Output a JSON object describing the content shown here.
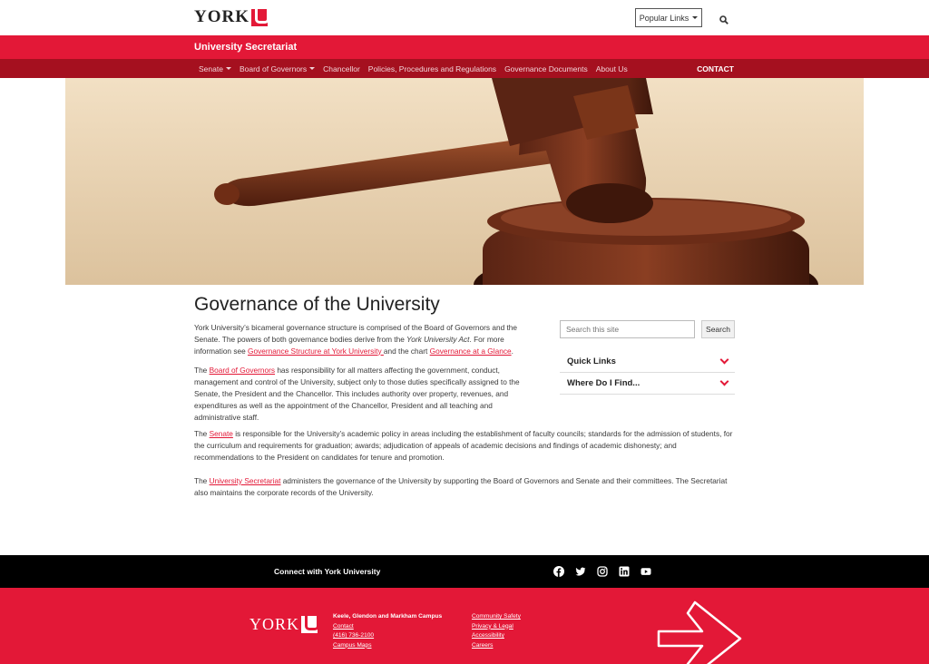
{
  "header": {
    "logo_text": "YORK",
    "popular_links_label": "Popular Links"
  },
  "site": {
    "title": "University Secretariat"
  },
  "nav": {
    "items": [
      {
        "label": "Senate",
        "dropdown": true
      },
      {
        "label": "Board of Governors",
        "dropdown": true
      },
      {
        "label": "Chancellor",
        "dropdown": false
      },
      {
        "label": "Policies, Procedures and Regulations",
        "dropdown": false
      },
      {
        "label": "Governance Documents",
        "dropdown": false
      },
      {
        "label": "About Us",
        "dropdown": false
      }
    ],
    "contact_label": "CONTACT"
  },
  "main": {
    "title": "Governance of the University",
    "p1": {
      "t1": "York University’s bicameral governance structure is comprised of the Board of Governors and the Senate. The powers of both governance bodies derive from the ",
      "em": "York University Act",
      "t2": ". For more information see ",
      "link1": "Governance Structure at York University ",
      "t3": "and the chart ",
      "link2": "Governance at a Glance",
      "t4": "."
    },
    "p2": {
      "t1": "The ",
      "link": "Board of Governors",
      "t2": " has responsibility for all matters affecting the government, conduct, management and control of the University, subject only to those duties specifically assigned to the Senate, the President and the Chancellor. This includes authority over property, revenues, and expenditures as well as the appointment of the Chancellor, President and all teaching and administrative staff."
    },
    "p3": {
      "t1": "The ",
      "link": "Senate",
      "t2": " is responsible for the University’s academic policy in areas including the establishment of faculty councils; standards for the admission of students, for the curriculum and requirements for graduation; awards; adjudication of appeals of academic decisions and findings of academic dishonesty; and recommendations to the President on candidates for tenure and promotion."
    },
    "p4": {
      "t1": "The ",
      "link": "University Secretariat",
      "t2": " administers the governance of the University by supporting the Board of Governors and Senate and their committees. The Secretariat also maintains the corporate records of the University."
    }
  },
  "sidebar": {
    "search_placeholder": "Search this site",
    "search_button": "Search",
    "accordion": [
      {
        "label": "Quick Links"
      },
      {
        "label": "Where Do I Find..."
      }
    ]
  },
  "footer": {
    "connect_label": "Connect with York University",
    "social_icons": [
      "facebook-icon",
      "twitter-icon",
      "instagram-icon",
      "linkedin-icon",
      "youtube-icon"
    ],
    "logo_text": "YORK",
    "campus_heading": "Keele, Glendon and Markham Campus",
    "col1_links": [
      "Contact",
      "(416) 736-2100",
      "Campus Maps"
    ],
    "col2_links": [
      "Community Safety",
      "Privacy & Legal",
      "Accessibility",
      "Careers"
    ]
  },
  "colors": {
    "brand_red": "#e31837",
    "nav_dark_red": "#a5101f"
  }
}
